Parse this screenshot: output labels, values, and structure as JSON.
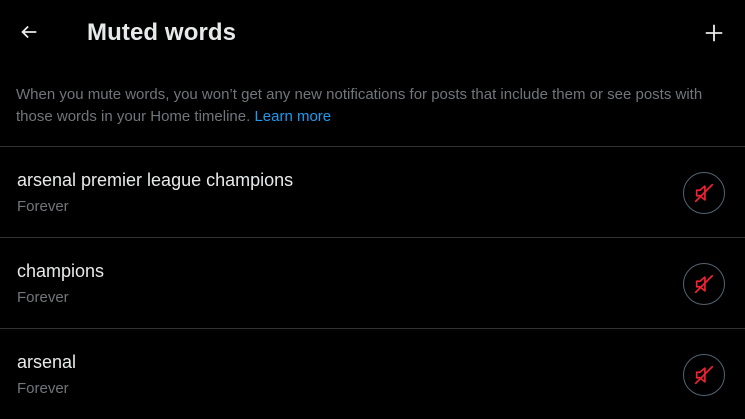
{
  "header": {
    "title": "Muted words",
    "back_icon": "arrow-left-icon",
    "add_icon": "plus-icon"
  },
  "description": {
    "text": "When you mute words, you won’t get any new notifications for posts that include them or see posts with those words in your Home timeline. ",
    "link_label": "Learn more"
  },
  "muted_words": [
    {
      "word": "arsenal premier league champions",
      "duration": "Forever",
      "action_icon": "speaker-muted-icon"
    },
    {
      "word": "champions",
      "duration": "Forever",
      "action_icon": "speaker-muted-icon"
    },
    {
      "word": "arsenal",
      "duration": "Forever",
      "action_icon": "speaker-muted-icon"
    }
  ],
  "colors": {
    "background": "#000000",
    "primary_text": "#e7e9ea",
    "secondary_text": "#71767b",
    "link": "#1d9bf0",
    "divider": "#2f3336",
    "unmute_accent": "#f4212e"
  }
}
